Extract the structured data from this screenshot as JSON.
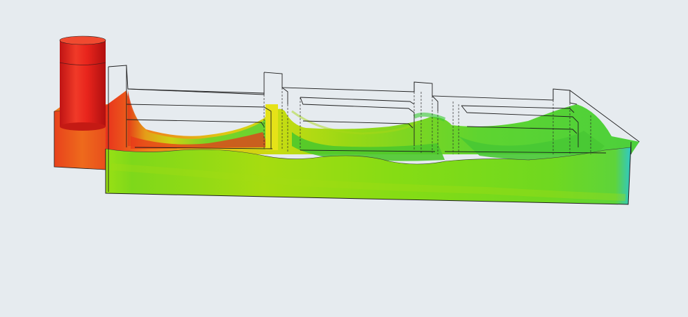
{
  "viewport": {
    "background": "#e6ebef"
  },
  "scene": {
    "colors": {
      "high": "#e8241c",
      "mid_high": "#f08a1a",
      "mid": "#d8dc10",
      "mid_low": "#86e010",
      "low": "#30d030",
      "lowest": "#20c8d8",
      "outline": "#1e1e1e"
    },
    "parts": [
      "sprue-cylinder",
      "runner-block",
      "cavity-box",
      "fill-surface",
      "wireframe-outline"
    ]
  }
}
